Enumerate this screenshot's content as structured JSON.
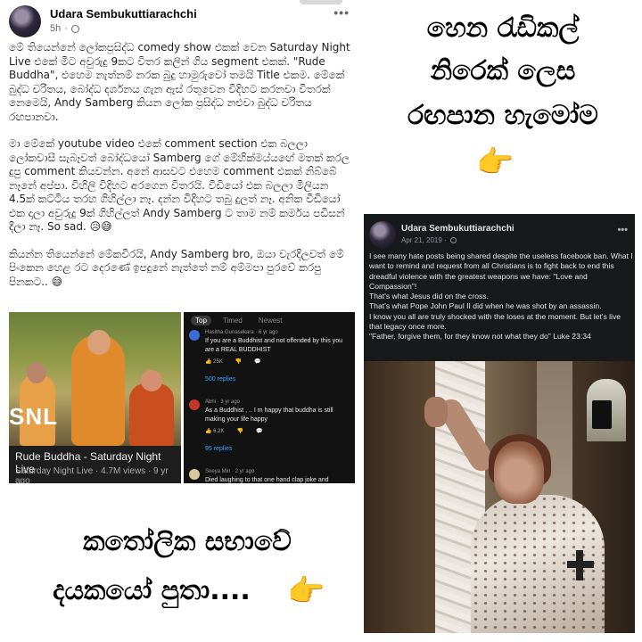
{
  "left_post": {
    "author": "Udara Sembukuttiarachchi",
    "time": "5h",
    "more": "•••",
    "paragraphs": [
      "මේ තියෙන්නේ ලෝකප්‍රසිද්ධ comedy show එකක් වෙන Saturday Night Live එකේ මීට අවුරුදු 9කට විතර කලින් ගිය segment එකක්. \"Rude Buddha\", එහෙම නැත්නම් නරක බුදු හාමුරුවෝ තමයි Title එකම. මේකේ බුද්ධ චරිතය, බෝද්ධ දර්ශනය ගැන ඇස් රතුවෙන විදිහට කරනවා විතරක් නෙමෙයි, Andy Samberg කියන ලෝක ප්‍රසිද්ධ නළුවා බුද්ධ චරිතය රඟපානවා.",
      "මා මේකේ youtube video එකේ comment section එක බලලා ලෝකවාසී සැබෑවත් බෝද්ධයෝ Samberg ගේ මේහික්මය්යඟේ මතක් කරල දුපු comment කියවන්න. අනේ ආසවට එහෙම comment එකක් නිබ්බේ නෑනේ අප්පා. විහිලි විදිහට අරගෙන විතරයි. වීඩියෝ එක බලලා මිලියන 4.5ක් කට්ටිය තරහ ගිහිල්ලා නෑ. දන්න විදිහට තබු දුලත් නෑ. අනික වීඩියෝ එක දාලා අවුරුදු 9ක් ගිහිල්ලත් Andy Samberg ට තාම නම් කර්මය පඩිසන් දීලා නෑ. So sad. 😥😅",
      "කියන්න තියෙන්නේ මේකවිරයි, Andy Samberg bro, ඔයා වැරදිලවත් මේ පිංකෙන හෙළ රට දෙරණේ ඉපදුනේ නැත්තේ නම් අම්මපා පුරවේ කරපු පිනකට.. 😅"
    ]
  },
  "video": {
    "logo": "SNL",
    "title": "Rude Buddha - Saturday Night Live",
    "meta": "Saturday Night Live · 4.7M views · 9 yr ago"
  },
  "comments_panel": {
    "tabs": [
      "Top",
      "Timed",
      "Newest"
    ],
    "comments": [
      {
        "author": "Hasitha Gunasekara · 6 yr ago",
        "text": "If you are a Buddhist and not offended by this you are a REAL BUDDHIST",
        "likes": "25K",
        "replies": "500 replies",
        "avatar_color": "#3b6fd4"
      },
      {
        "author": "Abhi · 3 yr ago",
        "text": "As a Buddhist , .. I m happy that buddha is still making your life happy",
        "likes": "6.2K",
        "replies": "95 replies",
        "avatar_color": "#c0392b"
      },
      {
        "author": "Sneya Min · 2 yr ago",
        "text": "Died laughing to that one hand clap joke and",
        "avatar_color": "#d8c7a0"
      }
    ]
  },
  "caption_left": {
    "line1": "කතෝලික සභාවේ",
    "line2": "දයකයෝ පුතා....",
    "pointer": "👉"
  },
  "caption_right": {
    "line1": "හෙන රැඩිකල්",
    "line2": "නිරෙක් ලෙස",
    "line3": "රඟපාන හැමෝම",
    "pointer": "👉"
  },
  "right_post": {
    "author": "Udara Sembukuttiarachchi",
    "time": "Apr 21, 2019 ·",
    "more": "•••",
    "lines": [
      "I see many hate posts being shared despite the useless facebook ban. What I want to remind and request from all Christians is to fight back to end this dreadful violence with the greatest weapons we have: \"Love and Compassion\"!",
      "That's what Jesus did on the cross.",
      "That's what Pope John Paul II did when he was shot by an assassin.",
      "I know you all are truly shocked with the loses at the moment. But let's live that legacy once more.",
      "\"Father, forgive them, for they know not what they do\" Luke 23:34"
    ]
  }
}
